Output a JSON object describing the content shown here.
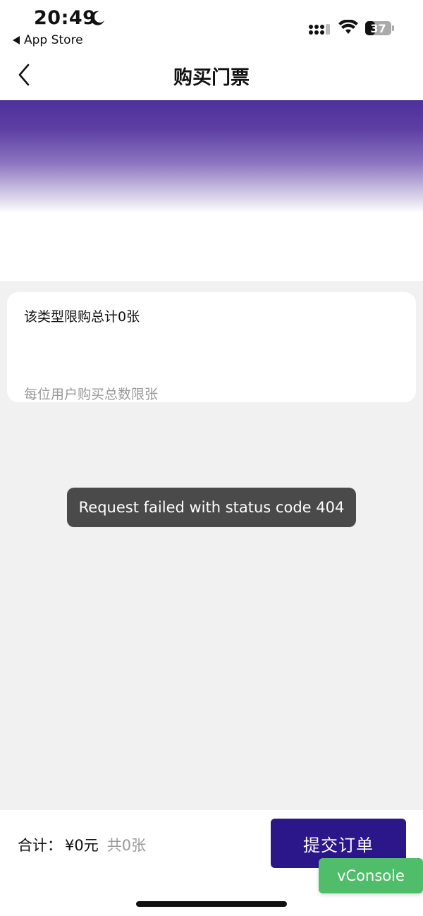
{
  "status_bar": {
    "time": "20:49",
    "back_app": "App Store",
    "battery": "37",
    "icons": [
      "moon-icon",
      "signal-icon",
      "wifi-icon",
      "battery-icon"
    ]
  },
  "nav": {
    "title": "购买门票",
    "back_icon": "chevron-left-icon"
  },
  "banner": {
    "accent_color": "#4e319a"
  },
  "card": {
    "title": "该类型限购总计0张",
    "subtitle": "每位用户购买总数限张"
  },
  "toast": {
    "message": "Request failed with status code 404"
  },
  "bottom_bar": {
    "total_label": "合计：",
    "total_price": "¥0元",
    "total_count": "共0张",
    "submit_label": "提交订单",
    "submit_color": "#2b168a"
  },
  "vconsole": {
    "label": "vConsole",
    "color": "#4fbd6a"
  }
}
